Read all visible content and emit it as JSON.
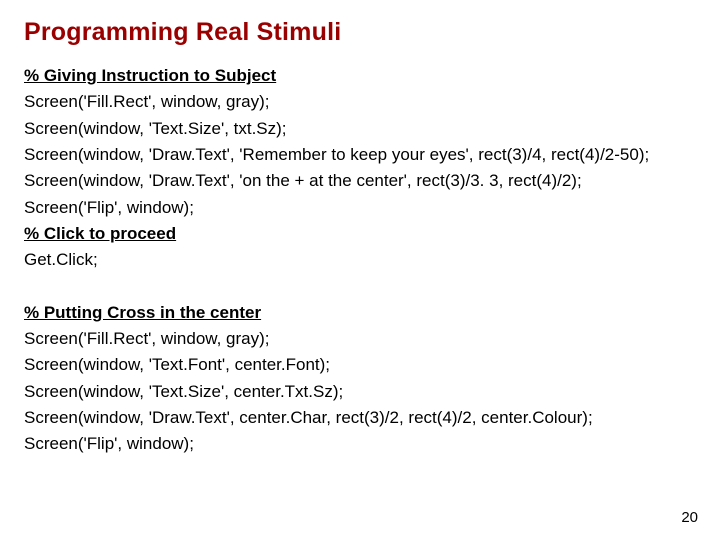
{
  "title": "Programming Real Stimuli",
  "section1": {
    "comment1": "% Giving Instruction to Subject",
    "l1": "Screen('Fill.Rect', window, gray);",
    "l2": "Screen(window, 'Text.Size', txt.Sz);",
    "l3": "Screen(window, 'Draw.Text', 'Remember to keep your eyes', rect(3)/4, rect(4)/2-50);",
    "l4": "Screen(window, 'Draw.Text', 'on the + at the center', rect(3)/3. 3, rect(4)/2);",
    "l5": "Screen('Flip', window);",
    "comment2": "% Click to proceed",
    "l6": "Get.Click;"
  },
  "section2": {
    "comment1": "% Putting Cross in the center",
    "l1": "Screen('Fill.Rect', window, gray);",
    "l2": "Screen(window, 'Text.Font', center.Font);",
    "l3": "Screen(window, 'Text.Size', center.Txt.Sz);",
    "l4": "Screen(window, 'Draw.Text', center.Char, rect(3)/2, rect(4)/2, center.Colour);",
    "l5": "Screen('Flip', window);"
  },
  "page_number": "20"
}
